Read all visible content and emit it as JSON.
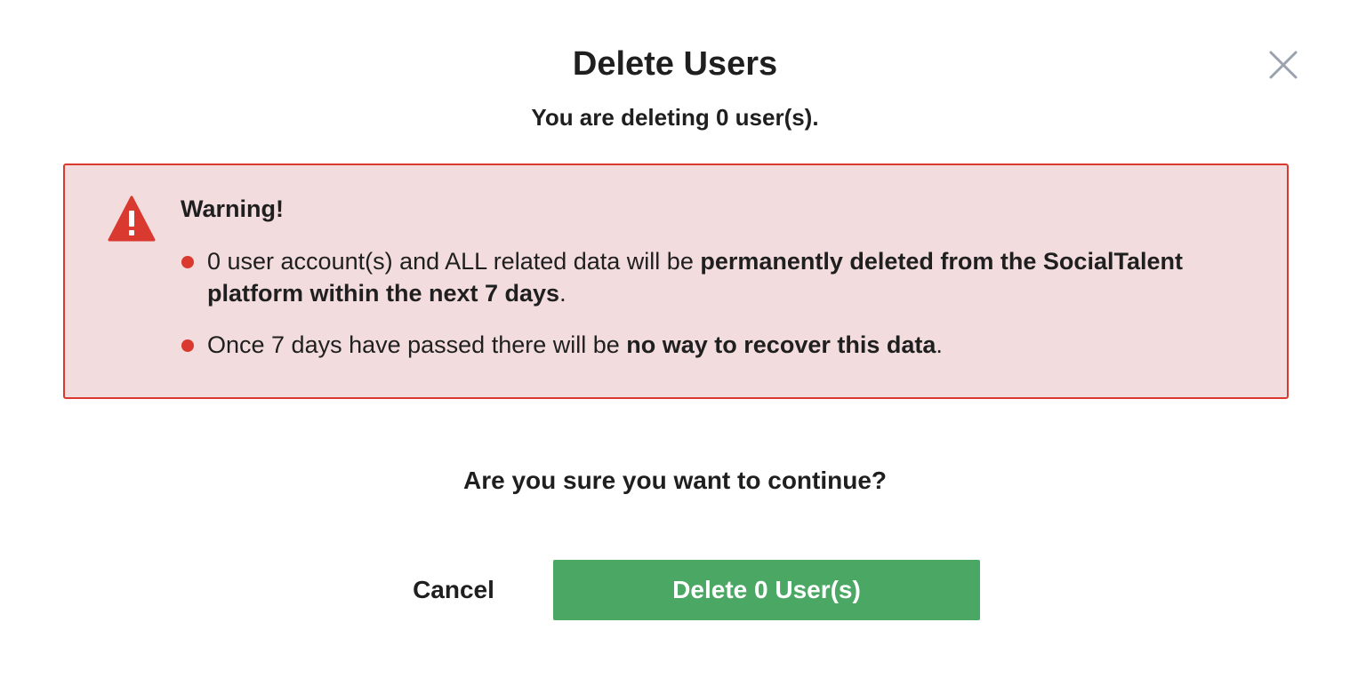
{
  "dialog": {
    "title": "Delete Users",
    "subtitle": "You are deleting 0 user(s).",
    "close_icon": "close-icon"
  },
  "warning": {
    "icon": "warning-triangle-icon",
    "heading": "Warning!",
    "items": [
      {
        "text_before": "0 user account(s) and ALL related data will be ",
        "text_bold": "permanently deleted from the SocialTalent platform within the next 7 days",
        "text_after": "."
      },
      {
        "text_before": "Once 7 days have passed there will be ",
        "text_bold": "no way to recover this data",
        "text_after": "."
      }
    ]
  },
  "confirm": {
    "question": "Are you sure you want to continue?",
    "cancel_label": "Cancel",
    "delete_label": "Delete 0 User(s)"
  },
  "colors": {
    "danger": "#d9392e",
    "warning_bg": "#f2dcdd",
    "primary_button": "#4aa764",
    "close_icon": "#9aa3ad"
  }
}
